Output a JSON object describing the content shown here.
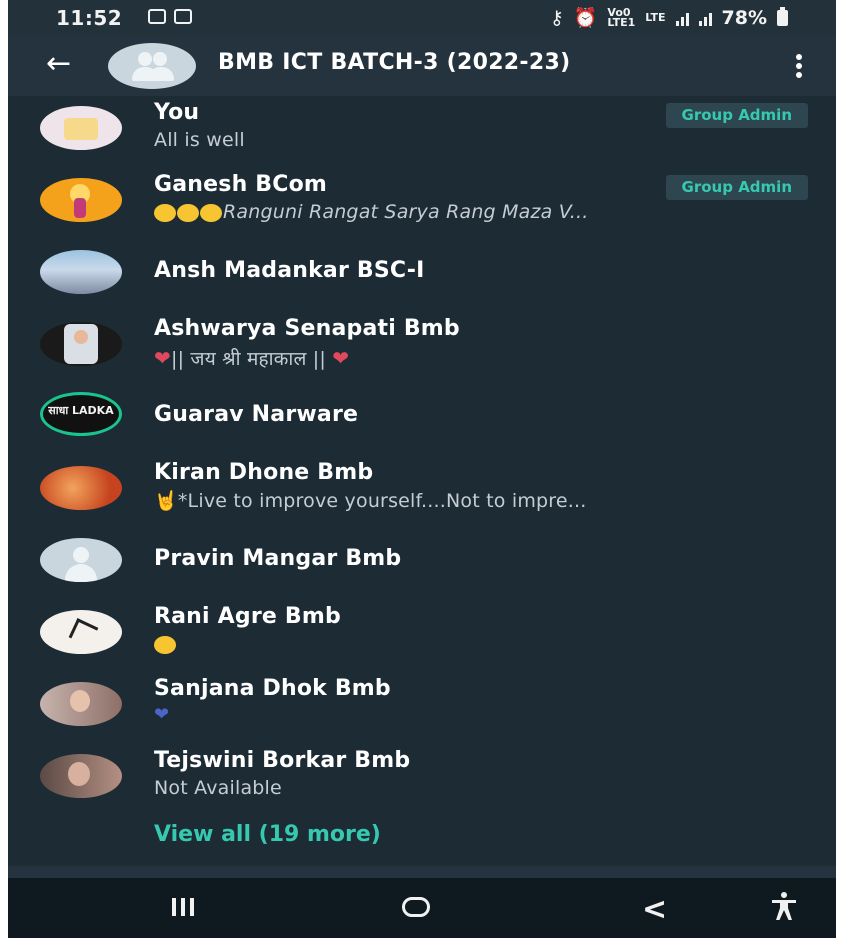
{
  "status_bar": {
    "time": "11:52",
    "network_top": "Vo0",
    "network_bottom": "LTE1",
    "lte_label": "LTE",
    "battery": "78%"
  },
  "header": {
    "title": "BMB ICT BATCH-3 (2022-23)"
  },
  "members": [
    {
      "name": "You",
      "about": "All is well",
      "badge": "Group Admin",
      "avatar_color": "#efe4ea"
    },
    {
      "name": "Ganesh BCom",
      "about_text": "Ranguni Rangat Sarya Rang Maza V...",
      "badge": "Group Admin",
      "avatar_color": "#f4a21b"
    },
    {
      "name": "Ansh Madankar BSC-I",
      "avatar_color": "#8fb6d4"
    },
    {
      "name": "Ashwarya Senapati Bmb",
      "about_text": "|| जय श्री महाकाल ||",
      "avatar_color": "#d9dfe4"
    },
    {
      "name": "Guarav Narware",
      "avatar_text": "साधा LADKA",
      "avatar_color": "#111111"
    },
    {
      "name": "Kiran Dhone Bmb",
      "about_text": "*Live to improve yourself....Not to impre...",
      "avatar_color": "#e06a2a"
    },
    {
      "name": "Pravin Mangar Bmb",
      "avatar_color": "#c9d6de"
    },
    {
      "name": "Rani Agre Bmb",
      "avatar_color": "#f4f0ec"
    },
    {
      "name": "Sanjana Dhok Bmb",
      "avatar_color": "#c7b3ad"
    },
    {
      "name": "Tejswini Borkar Bmb",
      "about": "Not Available",
      "avatar_color": "#9d7d72"
    }
  ],
  "view_all": "View all (19 more)",
  "colors": {
    "background": "#1d2b35",
    "header": "#24333d",
    "accent": "#36c9b0",
    "badge_bg": "#2d4650"
  },
  "icons": [
    "back-arrow-icon",
    "group-avatar-icon",
    "more-vert-icon",
    "recents-icon",
    "home-icon",
    "nav-back-icon",
    "accessibility-icon"
  ]
}
